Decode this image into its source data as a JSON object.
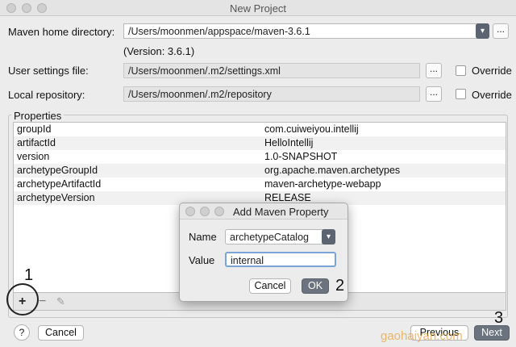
{
  "window": {
    "title": "New Project"
  },
  "maven": {
    "home_label": "Maven home directory:",
    "home_value": "/Users/moonmen/appspace/maven-3.6.1",
    "version": "(Version: 3.6.1)",
    "settings_label": "User settings file:",
    "settings_value": "/Users/moonmen/.m2/settings.xml",
    "repo_label": "Local repository:",
    "repo_value": "/Users/moonmen/.m2/repository",
    "override_label": "Override",
    "browse_label": "..."
  },
  "properties": {
    "legend": "Properties",
    "rows": [
      {
        "key": "groupId",
        "value": "com.cuiweiyou.intellij"
      },
      {
        "key": "artifactId",
        "value": "HelloIntellij"
      },
      {
        "key": "version",
        "value": "1.0-SNAPSHOT"
      },
      {
        "key": "archetypeGroupId",
        "value": "org.apache.maven.archetypes"
      },
      {
        "key": "archetypeArtifactId",
        "value": "maven-archetype-webapp"
      },
      {
        "key": "archetypeVersion",
        "value": "RELEASE"
      }
    ],
    "toolbar": {
      "add": "+",
      "remove": "−",
      "edit": "✎"
    }
  },
  "dialog": {
    "title": "Add Maven Property",
    "name_label": "Name",
    "name_value": "archetypeCatalog",
    "value_label": "Value",
    "value_value": "internal",
    "cancel": "Cancel",
    "ok": "OK"
  },
  "footer": {
    "help": "?",
    "cancel": "Cancel",
    "previous": "Previous",
    "next": "Next"
  },
  "annotations": {
    "one": "1",
    "two": "2",
    "three": "3"
  },
  "watermark": "gaohaiyan.com"
}
